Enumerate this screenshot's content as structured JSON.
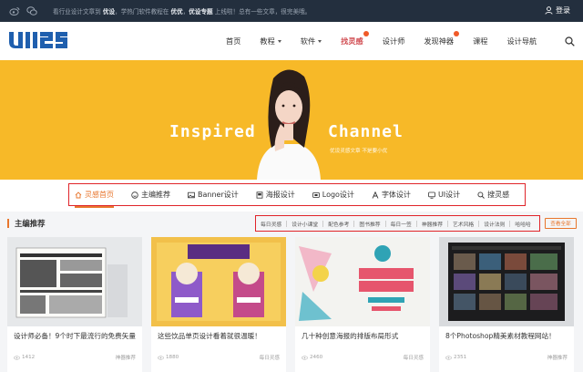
{
  "topbar": {
    "notice_parts": [
      "看行业设计文章到 ",
      "优设",
      "，学热门软件教程在 ",
      "优优",
      "，",
      "优设专题",
      " 上线啦！总有一些文章，很完美哦。"
    ],
    "login_label": "登录"
  },
  "nav": {
    "items": [
      {
        "label": "首页",
        "caret": false,
        "dot": false,
        "active": false
      },
      {
        "label": "教程",
        "caret": true,
        "dot": false,
        "active": false
      },
      {
        "label": "软件",
        "caret": true,
        "dot": false,
        "active": false
      },
      {
        "label": "找灵感",
        "caret": false,
        "dot": true,
        "active": true
      },
      {
        "label": "设计师",
        "caret": false,
        "dot": false,
        "active": false
      },
      {
        "label": "发现神器",
        "caret": false,
        "dot": true,
        "active": false
      },
      {
        "label": "课程",
        "caret": false,
        "dot": false,
        "active": false
      },
      {
        "label": "设计导航",
        "caret": false,
        "dot": false,
        "active": false
      }
    ]
  },
  "banner": {
    "left_text": "Inspired",
    "right_text": "Channel",
    "sub_text": "优设灵感文章 不是要小优"
  },
  "tabs": [
    {
      "label": "灵感首页",
      "icon": "home-icon",
      "active": true
    },
    {
      "label": "主编推荐",
      "icon": "smile-icon",
      "active": false
    },
    {
      "label": "Banner设计",
      "icon": "image-icon",
      "active": false
    },
    {
      "label": "海报设计",
      "icon": "poster-icon",
      "active": false
    },
    {
      "label": "Logo设计",
      "icon": "logo-icon",
      "active": false
    },
    {
      "label": "字体设计",
      "icon": "font-icon",
      "active": false
    },
    {
      "label": "UI设计",
      "icon": "monitor-icon",
      "active": false
    },
    {
      "label": "搜灵感",
      "icon": "search-icon",
      "active": false
    }
  ],
  "section": {
    "title": "主编推荐",
    "filters": [
      "每日灵感",
      "设计小课堂",
      "配色参考",
      "图书推荐",
      "每日一签",
      "神器推荐",
      "艺术风格",
      "设计法则",
      "哈哈哈"
    ],
    "see_all": "查看全部"
  },
  "cards": [
    {
      "title": "设计师必备！9个时下最流行的免费矢量",
      "views": "1412",
      "tag": "神器推荐"
    },
    {
      "title": "这些饮品单页设计看着就很温暖！",
      "views": "1880",
      "tag": "每日灵感"
    },
    {
      "title": "几十种创意海报的排版布局形式",
      "views": "2460",
      "tag": "每日灵感"
    },
    {
      "title": "8个Photoshop精美素材教程网站！",
      "views": "2351",
      "tag": "神器推荐"
    }
  ],
  "colors": {
    "topbar_bg": "#232f3e",
    "accent_orange": "#e8762d",
    "highlight_red": "#e0242a",
    "banner_yellow": "#f7b928",
    "nav_active": "#d04a4f"
  }
}
